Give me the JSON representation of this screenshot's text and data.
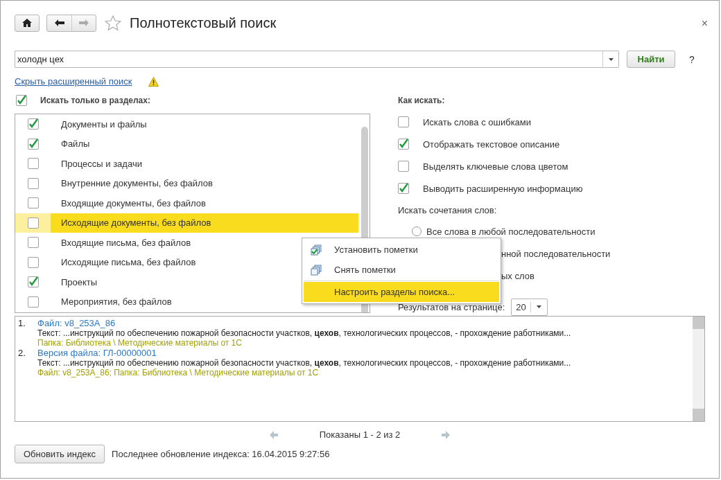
{
  "window": {
    "title": "Полнотекстовый поиск",
    "close": "×"
  },
  "search": {
    "value": "холодн цех",
    "button": "Найти",
    "help": "?"
  },
  "advanced_link": "Скрыть расширенный поиск",
  "sections": {
    "label": "Искать только в разделах:",
    "checked": true,
    "items": [
      {
        "label": "Документы и файлы",
        "checked": true,
        "selected": false
      },
      {
        "label": "Файлы",
        "checked": true,
        "selected": false
      },
      {
        "label": "Процессы и задачи",
        "checked": false,
        "selected": false
      },
      {
        "label": "Внутренние документы, без файлов",
        "checked": false,
        "selected": false
      },
      {
        "label": "Входящие документы, без файлов",
        "checked": false,
        "selected": false
      },
      {
        "label": "Исходящие документы, без файлов",
        "checked": false,
        "selected": true
      },
      {
        "label": "Входящие письма, без файлов",
        "checked": false,
        "selected": false
      },
      {
        "label": "Исходящие письма, без файлов",
        "checked": false,
        "selected": false
      },
      {
        "label": "Проекты",
        "checked": true,
        "selected": false
      },
      {
        "label": "Мероприятия, без файлов",
        "checked": false,
        "selected": false
      }
    ]
  },
  "how": {
    "label": "Как искать:",
    "options": [
      {
        "label": "Искать слова с ошибками",
        "checked": false
      },
      {
        "label": "Отображать текстовое описание",
        "checked": true
      },
      {
        "label": "Выделять ключевые слова цветом",
        "checked": false
      },
      {
        "label": "Выводить расширенную информацию",
        "checked": true
      }
    ],
    "combos_label": "Искать сочетания слов:",
    "combos": [
      {
        "kind": "radio",
        "label": "Все слова в любой последовательности",
        "selected": false
      },
      {
        "kind": "partial",
        "label": "нной последовательности"
      },
      {
        "kind": "partial",
        "label": "ых слов"
      }
    ],
    "per_page_label": "Результатов на странице:",
    "per_page": "20"
  },
  "context_menu": [
    {
      "kind": "mark-all",
      "label": "Установить пометки",
      "selected": false
    },
    {
      "kind": "unmark-all",
      "label": "Снять пометки",
      "selected": false
    },
    {
      "kind": "plain",
      "label": "Настроить разделы поиска...",
      "selected": true
    }
  ],
  "results": [
    {
      "number": "1.",
      "title": "Файл: v8_253A_86",
      "text": "Текст: ...инструкций по обеспечению пожарной безопасности участков, **цехов**, технологических процессов, - прохождение работниками...",
      "path": "Папка: Библиотека \\ Методические материалы от 1С"
    },
    {
      "number": "2.",
      "title": "Версия файла: ГЛ-00000001",
      "text": "Текст: ...инструкций по обеспечению пожарной безопасности участков, **цехов**, технологических процессов, - прохождение работниками...",
      "path": "Файл: v8_253A_86; Папка: Библиотека \\ Методические материалы от 1С"
    }
  ],
  "pager": "Показаны 1 - 2 из 2",
  "footer": {
    "button": "Обновить индекс",
    "status": "Последнее обновление индекса: 16.04.2015 9:27:56"
  }
}
